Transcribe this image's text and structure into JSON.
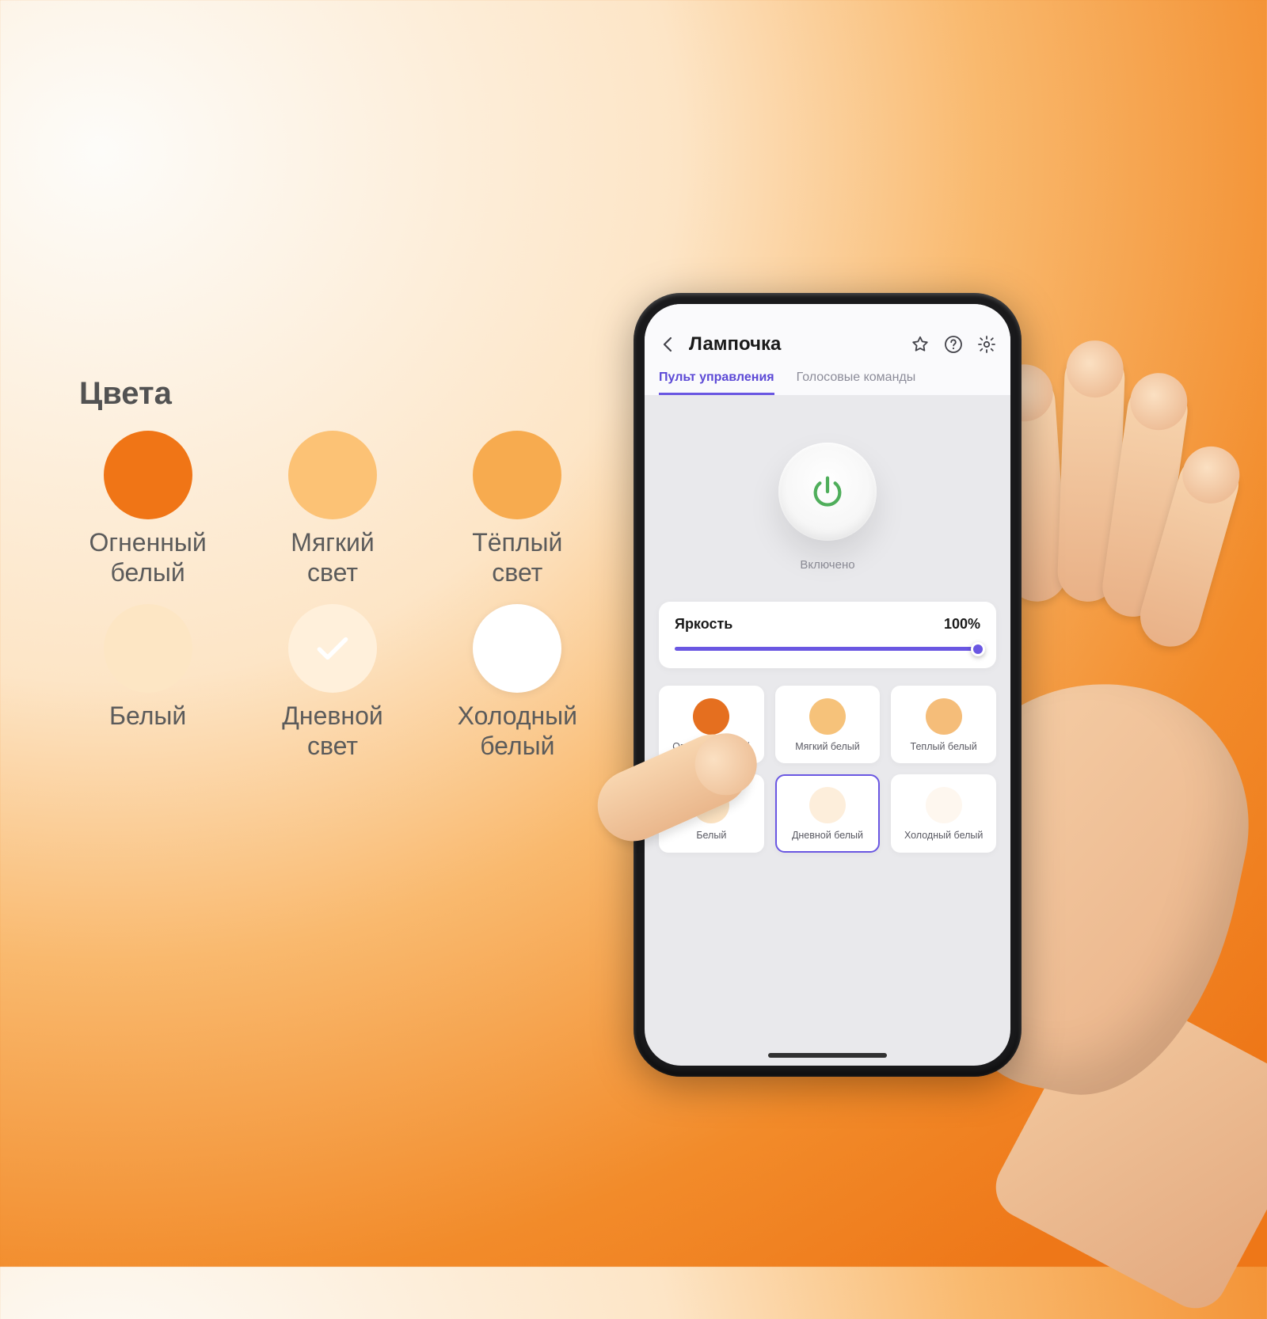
{
  "palette": {
    "title": "Цвета",
    "items": [
      {
        "label": "Огненный\nбелый",
        "color": "#f07516",
        "check": false
      },
      {
        "label": "Мягкий свет",
        "color": "#fcc275",
        "check": false
      },
      {
        "label": "Тёплый свет",
        "color": "#f7ab4f",
        "check": false
      },
      {
        "label": "Белый",
        "color": "#fde6c4",
        "check": false
      },
      {
        "label": "Дневной свет",
        "color": "#fff0db",
        "check": true
      },
      {
        "label": "Холодный\nбелый",
        "color": "#ffffff",
        "check": false
      }
    ]
  },
  "phone": {
    "title": "Лампочка",
    "icons": {
      "back": "back-icon",
      "star": "star-icon",
      "help": "help-icon",
      "settings": "gear-icon"
    },
    "tabs": [
      {
        "label": "Пульт управления",
        "active": true
      },
      {
        "label": "Голосовые команды",
        "active": false
      }
    ],
    "power_status": "Включено",
    "brightness": {
      "label": "Яркость",
      "value": "100%",
      "percent": 100
    },
    "tiles": [
      {
        "label": "Огненный белый",
        "color": "#e56f1f",
        "selected": false
      },
      {
        "label": "Мягкий белый",
        "color": "#f6c27a",
        "selected": false
      },
      {
        "label": "Теплый белый",
        "color": "#f5bd79",
        "selected": false
      },
      {
        "label": "Белый",
        "color": "#fbe2c1",
        "selected": false
      },
      {
        "label": "Дневной белый",
        "color": "#fdeedb",
        "selected": true
      },
      {
        "label": "Холодный белый",
        "color": "#fef7ef",
        "selected": false
      }
    ]
  },
  "accent": "#6a57e2"
}
